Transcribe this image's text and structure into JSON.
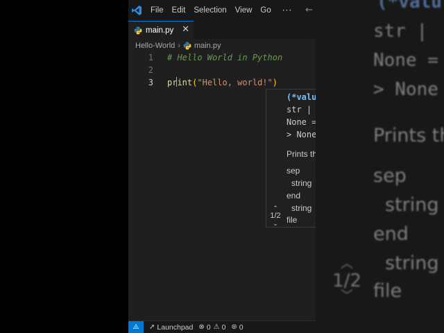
{
  "menu": {
    "file": "File",
    "edit": "Edit",
    "selection": "Selection",
    "view": "View",
    "go": "Go",
    "more": "···"
  },
  "tab": {
    "label": "main.py",
    "close": "✕"
  },
  "breadcrumb": {
    "folder": "Hello-World",
    "sep": "›",
    "file": "main.py"
  },
  "code": {
    "lines": [
      {
        "number": "1",
        "text": "# Hello World in Python"
      },
      {
        "number": "2",
        "text": ""
      },
      {
        "number": "3",
        "func": "print",
        "paren_open": "(",
        "string": "\"Hello, world!\"",
        "paren_close": ")"
      }
    ]
  },
  "hover": {
    "sig1": "(*valu",
    "sig2": "str |",
    "sig3": "None =",
    "sig4": "> None",
    "doc": "Prints th",
    "p1": "sep",
    "p1_type": "string",
    "p2": "end",
    "p2_type": "string",
    "p3": "file",
    "pager": "1/2"
  },
  "zoom": {
    "sig1": "(*valu",
    "sig2": "str |",
    "sig3": "None =",
    "sig4": "> None",
    "doc": "Prints th",
    "p1": "sep",
    "p1_type": "string",
    "p2": "end",
    "p2_type": "string",
    "p3": "file",
    "pager": "1/2"
  },
  "status": {
    "launchpad": "Launchpad",
    "errors": "0",
    "warnings": "0",
    "ports": "0"
  },
  "colors": {
    "accent": "#0078d4",
    "editor_bg": "#1f1f1f",
    "comment": "#6a9955",
    "string": "#ce9178",
    "function": "#dcdcaa",
    "bracket": "#ffd700"
  }
}
